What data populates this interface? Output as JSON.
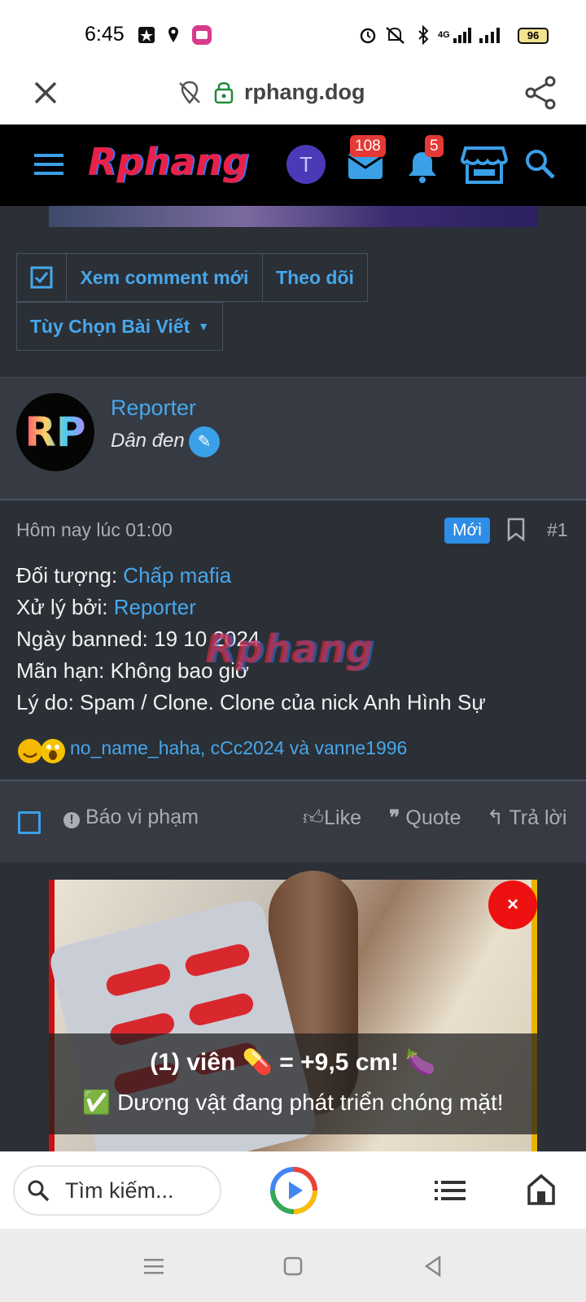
{
  "status_bar": {
    "time": "6:45",
    "battery": "96",
    "network": "4G"
  },
  "browser": {
    "url": "rphang.dog"
  },
  "header": {
    "logo": "Rphang",
    "avatar_letter": "T",
    "messages_count": "108",
    "alerts_count": "5"
  },
  "thread_buttons": {
    "new_comments": "Xem comment mới",
    "follow": "Theo dõi",
    "options": "Tùy Chọn Bài Viết"
  },
  "post": {
    "avatar_text": "RP",
    "username": "Reporter",
    "user_title": "Dân đen",
    "date": "Hôm nay lúc 01:00",
    "new_badge": "Mới",
    "post_number": "#1",
    "lines": {
      "target_label": "Đối tượng:",
      "target_value": "Chấp mafia",
      "handled_label": "Xử lý bởi:",
      "handled_value": "Reporter",
      "banned_date": "Ngày banned: 19 10 2024",
      "expiry": "Mãn hạn: Không bao giờ",
      "reason": "Lý do: Spam / Clone. Clone của nick Anh Hình Sự"
    },
    "watermark": "Rphang",
    "reactions": "no_name_haha, cCc2024 và vanne1996",
    "actions": {
      "report": "Báo vi phạm",
      "like": "Like",
      "quote": "Quote",
      "reply": "Trả lời"
    }
  },
  "ad": {
    "close": "×",
    "line1": "(1) viên 💊 = +9,5 cm! 🍆",
    "line2": "✅ Dương vật đang phát triển chóng mặt!"
  },
  "bottom_bar": {
    "search_placeholder": "Tìm kiếm..."
  },
  "colors": {
    "link": "#47a7eb",
    "background": "#2b2f36",
    "badge_red": "#e53935"
  }
}
